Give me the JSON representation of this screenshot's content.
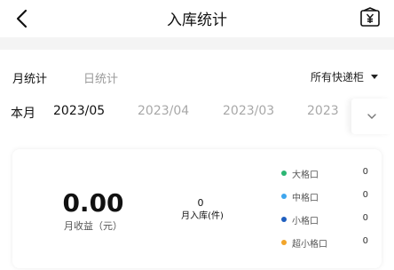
{
  "header": {
    "title": "入库统计",
    "back_icon": "chevron-left-icon",
    "wallet_icon": "wallet-yen-icon"
  },
  "tabs": [
    {
      "label": "月统计",
      "active": true
    },
    {
      "label": "日统计",
      "active": false
    }
  ],
  "cabinet_filter": {
    "label": "所有快递柜"
  },
  "period": {
    "label": "本月",
    "months": [
      {
        "label": "2023/05",
        "active": true
      },
      {
        "label": "2023/04",
        "active": false
      },
      {
        "label": "2023/03",
        "active": false
      },
      {
        "label": "2023",
        "active": false
      }
    ],
    "expand_icon": "chevron-down-icon"
  },
  "summary": {
    "income_value": "0.00",
    "income_label": "月收益（元）",
    "count_value": "0",
    "count_label": "月入库(件)"
  },
  "legend": [
    {
      "name": "大格口",
      "count": "0",
      "color": "#2bb673"
    },
    {
      "name": "中格口",
      "count": "0",
      "color": "#3ea6ee"
    },
    {
      "name": "小格口",
      "count": "0",
      "color": "#1f5fbf"
    },
    {
      "name": "超小格口",
      "count": "0",
      "color": "#f2a52a"
    }
  ]
}
